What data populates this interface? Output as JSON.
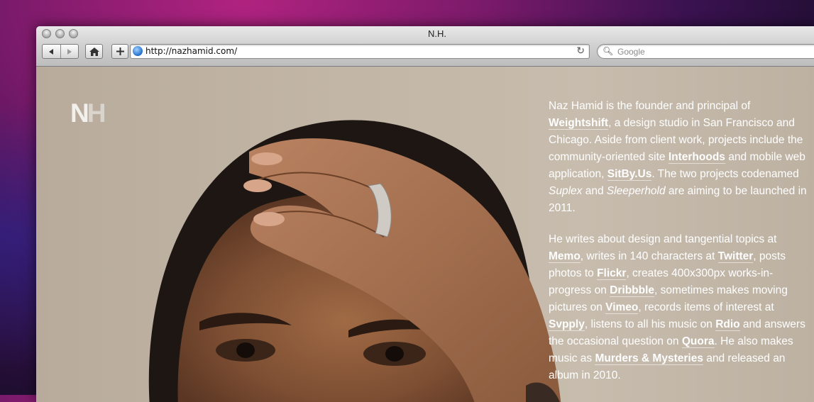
{
  "window": {
    "title": "N.H."
  },
  "toolbar": {
    "back_icon": "back-arrow-icon",
    "forward_icon": "forward-arrow-icon",
    "home_icon": "home-icon",
    "add_icon": "plus-icon",
    "url": "http://nazhamid.com/",
    "reload_icon": "reload-icon",
    "search_placeholder": "Google"
  },
  "page": {
    "logo": {
      "n": "N",
      "h": "H"
    },
    "p1": {
      "t1": "Naz Hamid is the founder and principal of ",
      "weightshift": "Weightshift",
      "t2": ", a design studio in San Francisco and Chicago. Aside from client work, projects include the community-oriented site ",
      "interhoods": "Interhoods",
      "t3": " and mobile web application, ",
      "sitbyus": "SitBy.Us",
      "t4": ". The two projects codenamed ",
      "suplex": "Suplex",
      "t5": " and ",
      "sleeperhold": "Sleeperhold",
      "t6": " are aiming to be launched in 2011."
    },
    "p2": {
      "t1": "He writes about design and tangential topics at ",
      "memo": "Memo",
      "t2": ", writes in 140 characters at ",
      "twitter": "Twitter",
      "t3": ", posts photos to ",
      "flickr": "Flickr",
      "t4": ", creates 400x300px works-in-progress on ",
      "dribbble": "Dribbble",
      "t5": ", sometimes makes moving pictures on ",
      "vimeo": "Vimeo",
      "t6": ", records items of interest at ",
      "svpply": "Svpply",
      "t7": ", listens to all his music on ",
      "rdio": "Rdio",
      "t8": " and answers the occasional question on ",
      "quora": "Quora",
      "t9": ". He also makes music as ",
      "murders": "Murders & Mysteries",
      "t10": " and released an album in 2010."
    }
  },
  "colors": {
    "wall": "#c2b6a6",
    "skin": "#8a5a3c",
    "hair": "#1e1612"
  }
}
